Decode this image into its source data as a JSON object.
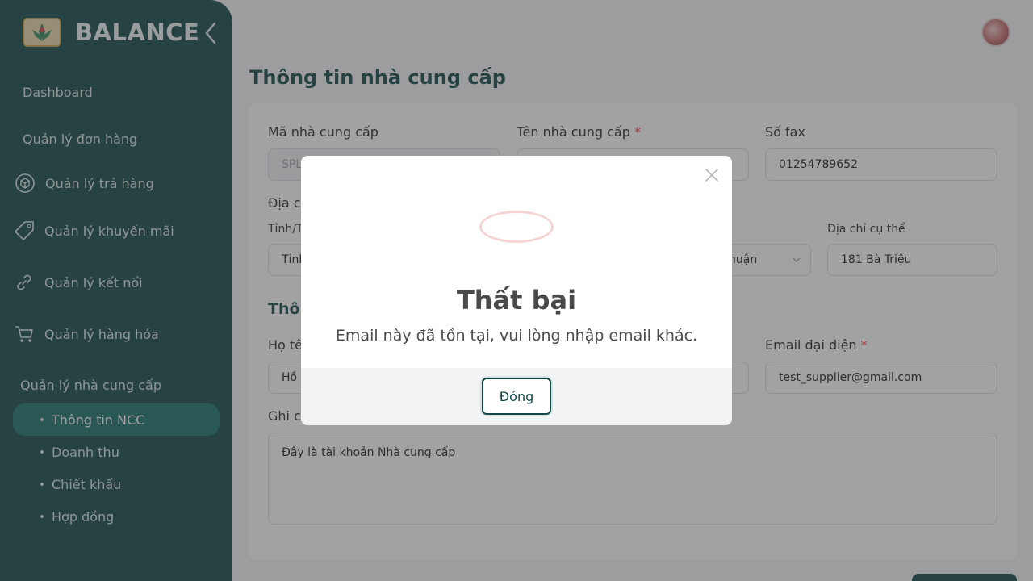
{
  "brand": {
    "name": "BALANCE"
  },
  "sidebar": {
    "items": [
      {
        "label": "Dashboard",
        "icon": ""
      },
      {
        "label": "Quản lý đơn hàng",
        "icon": ""
      },
      {
        "label": "Quản lý trả hàng",
        "icon": "return-box-icon"
      },
      {
        "label": "Quản lý khuyến mãi",
        "icon": "tag-icon"
      },
      {
        "label": "Quản lý kết nối",
        "icon": "link-icon"
      },
      {
        "label": "Quản lý hàng hóa",
        "icon": "cart-icon"
      },
      {
        "label": "Quản lý nhà cung cấp",
        "icon": ""
      }
    ],
    "sub_items": [
      {
        "label": "Thông tin NCC",
        "active": true
      },
      {
        "label": "Doanh thu",
        "active": false
      },
      {
        "label": "Chiết khấu",
        "active": false
      },
      {
        "label": "Hợp đồng",
        "active": false
      }
    ]
  },
  "page": {
    "title": "Thông tin nhà cung cấp"
  },
  "form": {
    "supplier_code_label": "Mã nhà cung cấp",
    "supplier_code_value": "SPL",
    "supplier_name_label": "Tên nhà cung cấp",
    "required_mark": "*",
    "fax_label": "Số fax",
    "fax_value": "01254789652",
    "address_label": "Địa ch",
    "province_label": "Tỉnh/T",
    "province_value": "Tỉnh",
    "ward_value": "huận",
    "street_label": "Địa chỉ cụ thể",
    "street_value": "181 Bà Triệu",
    "section_contact": "Thô",
    "rep_name_label": "Họ tê",
    "rep_name_value": "Hồ",
    "rep_email_label": "Email đại diện",
    "rep_email_value": "test_supplier@gmail.com",
    "note_label": "Ghi ch",
    "note_value": "Đây là tài khoản Nhà cung cấp"
  },
  "modal": {
    "title": "Thất bại",
    "message": "Email này đã tồn tại, vui lòng nhập email khác.",
    "close_button": "Đóng"
  },
  "colors": {
    "sidebar_bg": "#124746",
    "active_item": "#17716a",
    "required": "#e03b3b",
    "error_ring": "#f5d5d4"
  }
}
